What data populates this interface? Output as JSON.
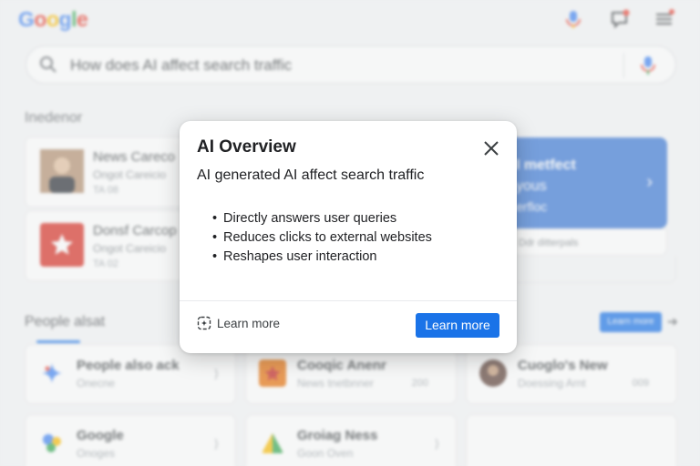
{
  "header": {
    "logo": {
      "letters": [
        "G",
        "o",
        "o",
        "g",
        "l",
        "e"
      ]
    },
    "mic_icon": "mic-icon",
    "messages_icon": "messages-icon",
    "menu_icon": "menu-icon"
  },
  "search": {
    "query": "How does AI affect search traffic",
    "search_icon": "search-icon",
    "mic_icon": "mic-icon"
  },
  "section_news": {
    "title": "Inedenor",
    "cards": [
      {
        "title": "News Careco",
        "source": "Ongot Careicio",
        "time": "TA 08",
        "thumb": "person-thumbnail"
      },
      {
        "title": "Donsf Carcop",
        "source": "Ongot Careicio",
        "time": "TA 02",
        "thumb": "star-thumbnail"
      }
    ]
  },
  "promo": {
    "line1": "I metfect",
    "line2": "yous",
    "line3": "erfloc",
    "sub": "Ddr ditterpals"
  },
  "section_people": {
    "title": "People alsat",
    "learn_more_small": "Learn more",
    "cards": [
      {
        "title": "People also ack",
        "sub": "Onecne",
        "icon": "gemini-icon"
      },
      {
        "title": "Cooqic Anenr",
        "sub": "News tnetbnner",
        "extra": "200",
        "icon": "news-icon"
      },
      {
        "title": "Cuoglo's New",
        "sub": "Doessing Arnt",
        "extra": "009",
        "icon": "person-avatar-icon"
      },
      {
        "title": "Google",
        "sub": "Onoges",
        "icon": "google-apps-icon"
      },
      {
        "title": "Groiag Ness",
        "sub": "Goon Oven",
        "icon": "triangle-icon"
      },
      {
        "title": "",
        "sub": "",
        "icon": ""
      }
    ]
  },
  "dialog": {
    "title": "AI Overview",
    "subtitle": "AI generated AI affect search traffic",
    "bullets": [
      "Directly answers user queries",
      "Reduces clicks to external websites",
      "Reshapes user interaction"
    ],
    "link_label": "Learn more",
    "primary_label": "Learn more",
    "close_icon": "close-icon",
    "link_icon": "sparkle-link-icon"
  },
  "colors": {
    "accent": "#1a73e8",
    "promo_bg": "#3b78d6",
    "google_blue": "#4285f4",
    "google_red": "#ea4335",
    "google_yellow": "#fbbc05",
    "google_green": "#34a853"
  }
}
